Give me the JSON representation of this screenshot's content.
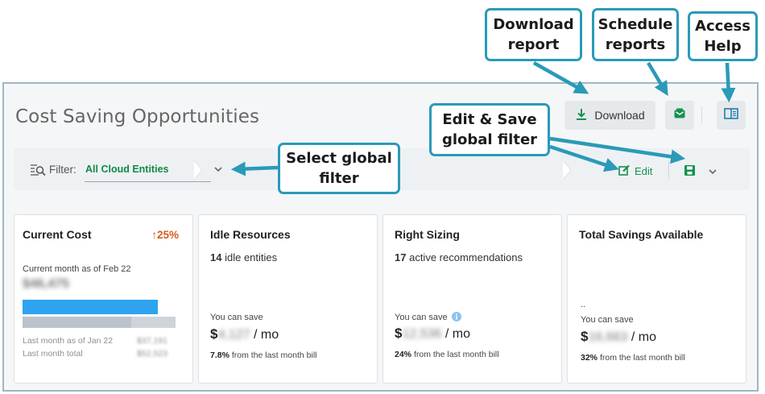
{
  "header": {
    "title": "Cost Saving Opportunities",
    "download_label": "Download"
  },
  "filter": {
    "label": "Filter:",
    "value": "All Cloud Entities",
    "edit_label": "Edit"
  },
  "cards": {
    "current_cost": {
      "title": "Current Cost",
      "change": "25%",
      "subtitle": "Current month as of Feb 22",
      "amount": "$46,475",
      "last_month_asof_label": "Last month as of Jan 22",
      "last_month_asof_value": "$37,191",
      "last_month_total_label": "Last month total",
      "last_month_total_value": "$52,523",
      "current_fraction": 0.885,
      "last_asof_fraction": 0.708
    },
    "idle_resources": {
      "title": "Idle Resources",
      "count": "14",
      "count_text": "idle entities",
      "save_label": "You can save",
      "amount": "4,127",
      "per": "/ mo",
      "pct": "7.8%",
      "pct_text": "from the last month bill"
    },
    "right_sizing": {
      "title": "Right Sizing",
      "count": "17",
      "count_text": "active recommendations",
      "save_label": "You can save",
      "amount": "12,536",
      "per": "/ mo",
      "pct": "24%",
      "pct_text": "from the last month bill"
    },
    "total_savings": {
      "title": "Total Savings Available",
      "dots": "..",
      "save_label": "You can save",
      "amount": "16,663",
      "per": "/ mo",
      "pct": "32%",
      "pct_text": "from the last month bill"
    }
  },
  "callouts": {
    "download": "Download report",
    "schedule": "Schedule reports",
    "help": "Access Help",
    "edit_save": "Edit & Save global filter",
    "select": "Select global filter"
  },
  "colors": {
    "accent_green": "#15924e",
    "callout_border": "#2a9ab8",
    "bar_blue": "#2fa3f0",
    "increase_orange": "#d85a1f"
  }
}
